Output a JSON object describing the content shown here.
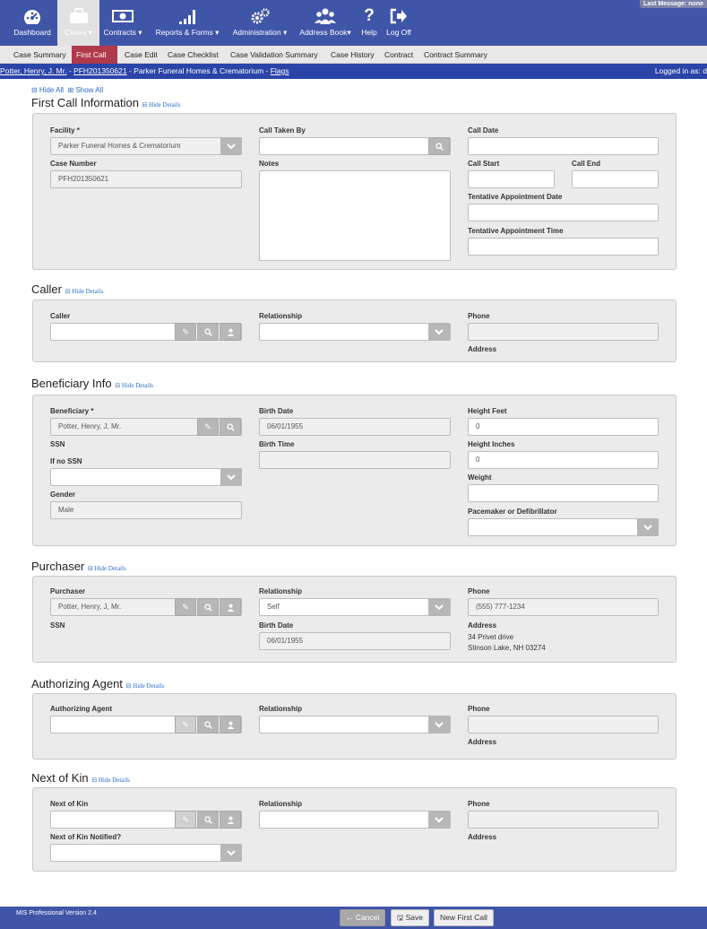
{
  "nav": {
    "items": [
      {
        "label": "Dashboard"
      },
      {
        "label": "Cases ▾"
      },
      {
        "label": "Contracts ▾"
      },
      {
        "label": "Reports & Forms ▾"
      },
      {
        "label": "Administration ▾"
      },
      {
        "label": "Address Book▾"
      },
      {
        "label": "Help"
      },
      {
        "label": "Log Off"
      }
    ],
    "last_message": "Last Message: none"
  },
  "subnav": [
    "Case Summary",
    "First Call",
    "Case Edit",
    "Case Checklist",
    "Case Validation Summary",
    "Case History",
    "Contract",
    "Contract Summary"
  ],
  "casebar": {
    "name": "Potter, Henry, J. Mr.",
    "sep1": " - ",
    "case_no": "PFH201350621",
    "sep2": " - Parker Funeral Homes & Crematorium - ",
    "flags": "Flags",
    "logged": "Logged in as: d"
  },
  "hide_all": "⊟ Hide All",
  "show_all": "⊞ Show All",
  "hide_details": "⊟ Hide Details",
  "first_call": {
    "title": "First Call Information",
    "facility_label": "Facility *",
    "facility_value": "Parker Funeral Homes & Crematorium",
    "case_number_label": "Case Number",
    "case_number_value": "PFH201350621",
    "call_taken_by_label": "Call Taken By",
    "notes_label": "Notes",
    "call_date_label": "Call Date",
    "call_start_label": "Call Start",
    "call_end_label": "Call End",
    "tent_date_label": "Tentative Appointment Date",
    "tent_time_label": "Tentative Appointment Time"
  },
  "caller": {
    "title": "Caller",
    "caller_label": "Caller",
    "relationship_label": "Relationship",
    "phone_label": "Phone",
    "address_label": "Address"
  },
  "beneficiary": {
    "title": "Beneficiary Info",
    "beneficiary_label": "Beneficiary *",
    "beneficiary_value": "Potter, Henry, J, Mr.",
    "ssn_label": "SSN",
    "if_no_ssn_label": "If no SSN",
    "gender_label": "Gender",
    "gender_value": "Male",
    "birth_date_label": "Birth Date",
    "birth_date_value": "06/01/1955",
    "birth_time_label": "Birth Time",
    "height_feet_label": "Height Feet",
    "height_feet_value": "0",
    "height_inches_label": "Height Inches",
    "height_inches_value": "0",
    "weight_label": "Weight",
    "pacemaker_label": "Pacemaker or Defibrillator"
  },
  "purchaser": {
    "title": "Purchaser",
    "purchaser_label": "Purchaser",
    "purchaser_value": "Potter, Henry, J, Mr.",
    "ssn_label": "SSN",
    "relationship_label": "Relationship",
    "relationship_value": "Self",
    "birth_date_label": "Birth Date",
    "birth_date_value": "06/01/1955",
    "phone_label": "Phone",
    "phone_value": "(555) 777-1234",
    "address_label": "Address",
    "address_line1": "34 Privet drive",
    "address_line2": "Stinson Lake, NH 03274"
  },
  "agent": {
    "title": "Authorizing Agent",
    "agent_label": "Authorizing Agent",
    "relationship_label": "Relationship",
    "phone_label": "Phone",
    "address_label": "Address"
  },
  "kin": {
    "title": "Next of Kin",
    "kin_label": "Next of Kin",
    "notified_label": "Next of Kin Notified?",
    "relationship_label": "Relationship",
    "phone_label": "Phone",
    "address_label": "Address"
  },
  "footer": {
    "version": "MIS Professional Version 2.4",
    "cancel": "← Cancel",
    "save": "🖫 Save",
    "new_first_call": "New First Call"
  }
}
